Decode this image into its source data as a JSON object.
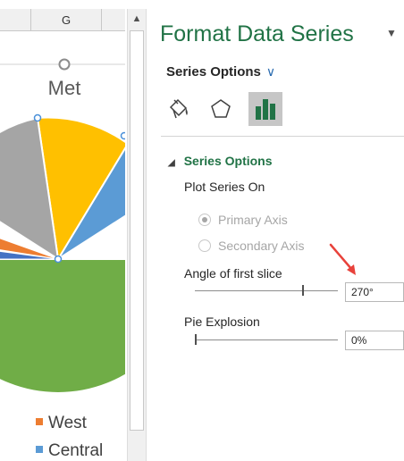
{
  "sheet": {
    "column_header": "G"
  },
  "chart": {
    "title": "Met",
    "legend": [
      {
        "label": "West",
        "color": "#ED7D31"
      },
      {
        "label": "Central",
        "color": "#5B9BD5"
      }
    ],
    "slice_colors": {
      "green": "#70AD47",
      "gray": "#A5A5A5",
      "yellow": "#FFC000",
      "blue": "#5B9BD5",
      "orange": "#ED7D31",
      "darkblue": "#4472C4"
    }
  },
  "pane": {
    "title": "Format Data Series",
    "options_dropdown": "Series Options",
    "tabs": [
      {
        "icon": "fill-bucket-icon"
      },
      {
        "icon": "pentagon-effects-icon"
      },
      {
        "icon": "bar-chart-icon",
        "selected": true
      }
    ],
    "section": {
      "title": "Series Options",
      "plot_series_on": "Plot Series On",
      "primary_axis": "Primary Axis",
      "secondary_axis": "Secondary Axis",
      "angle_label": "Angle of first slice",
      "angle_value": "270°",
      "explosion_label": "Pie Explosion",
      "explosion_value": "0%"
    },
    "accent_color": "#217346",
    "annotation_arrow_color": "#E8423B"
  }
}
